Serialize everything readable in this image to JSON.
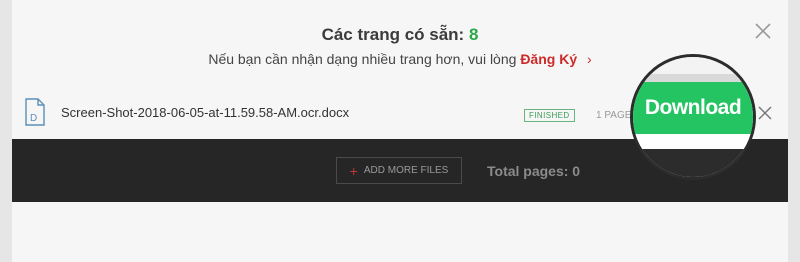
{
  "header": {
    "title_prefix": "Các trang có sẵn:",
    "available_count": "8",
    "subtitle": "Nếu bạn cần nhận dạng nhiều trang hơn, vui lòng",
    "register_link": "Đăng Ký",
    "register_chevron": "›",
    "close_icon": "close-icon"
  },
  "file_row": {
    "icon": "document-icon",
    "icon_letter": "D",
    "file_name": "Screen-Shot-2018-06-05-at-11.59.58-AM.ocr.docx",
    "status": "FINISHED",
    "pages": "1 PAGES",
    "close_icon": "close-icon"
  },
  "footer_bar": {
    "add_more_plus": "+",
    "add_more_label": "ADD MORE FILES",
    "total_pages": "Total pages: 0"
  },
  "magnifier": {
    "download_label": "Download"
  },
  "colors": {
    "accent_green": "#23c461",
    "count_green": "#2aa84a",
    "register_red": "#cc2b2b",
    "dark_bar": "#262626"
  }
}
